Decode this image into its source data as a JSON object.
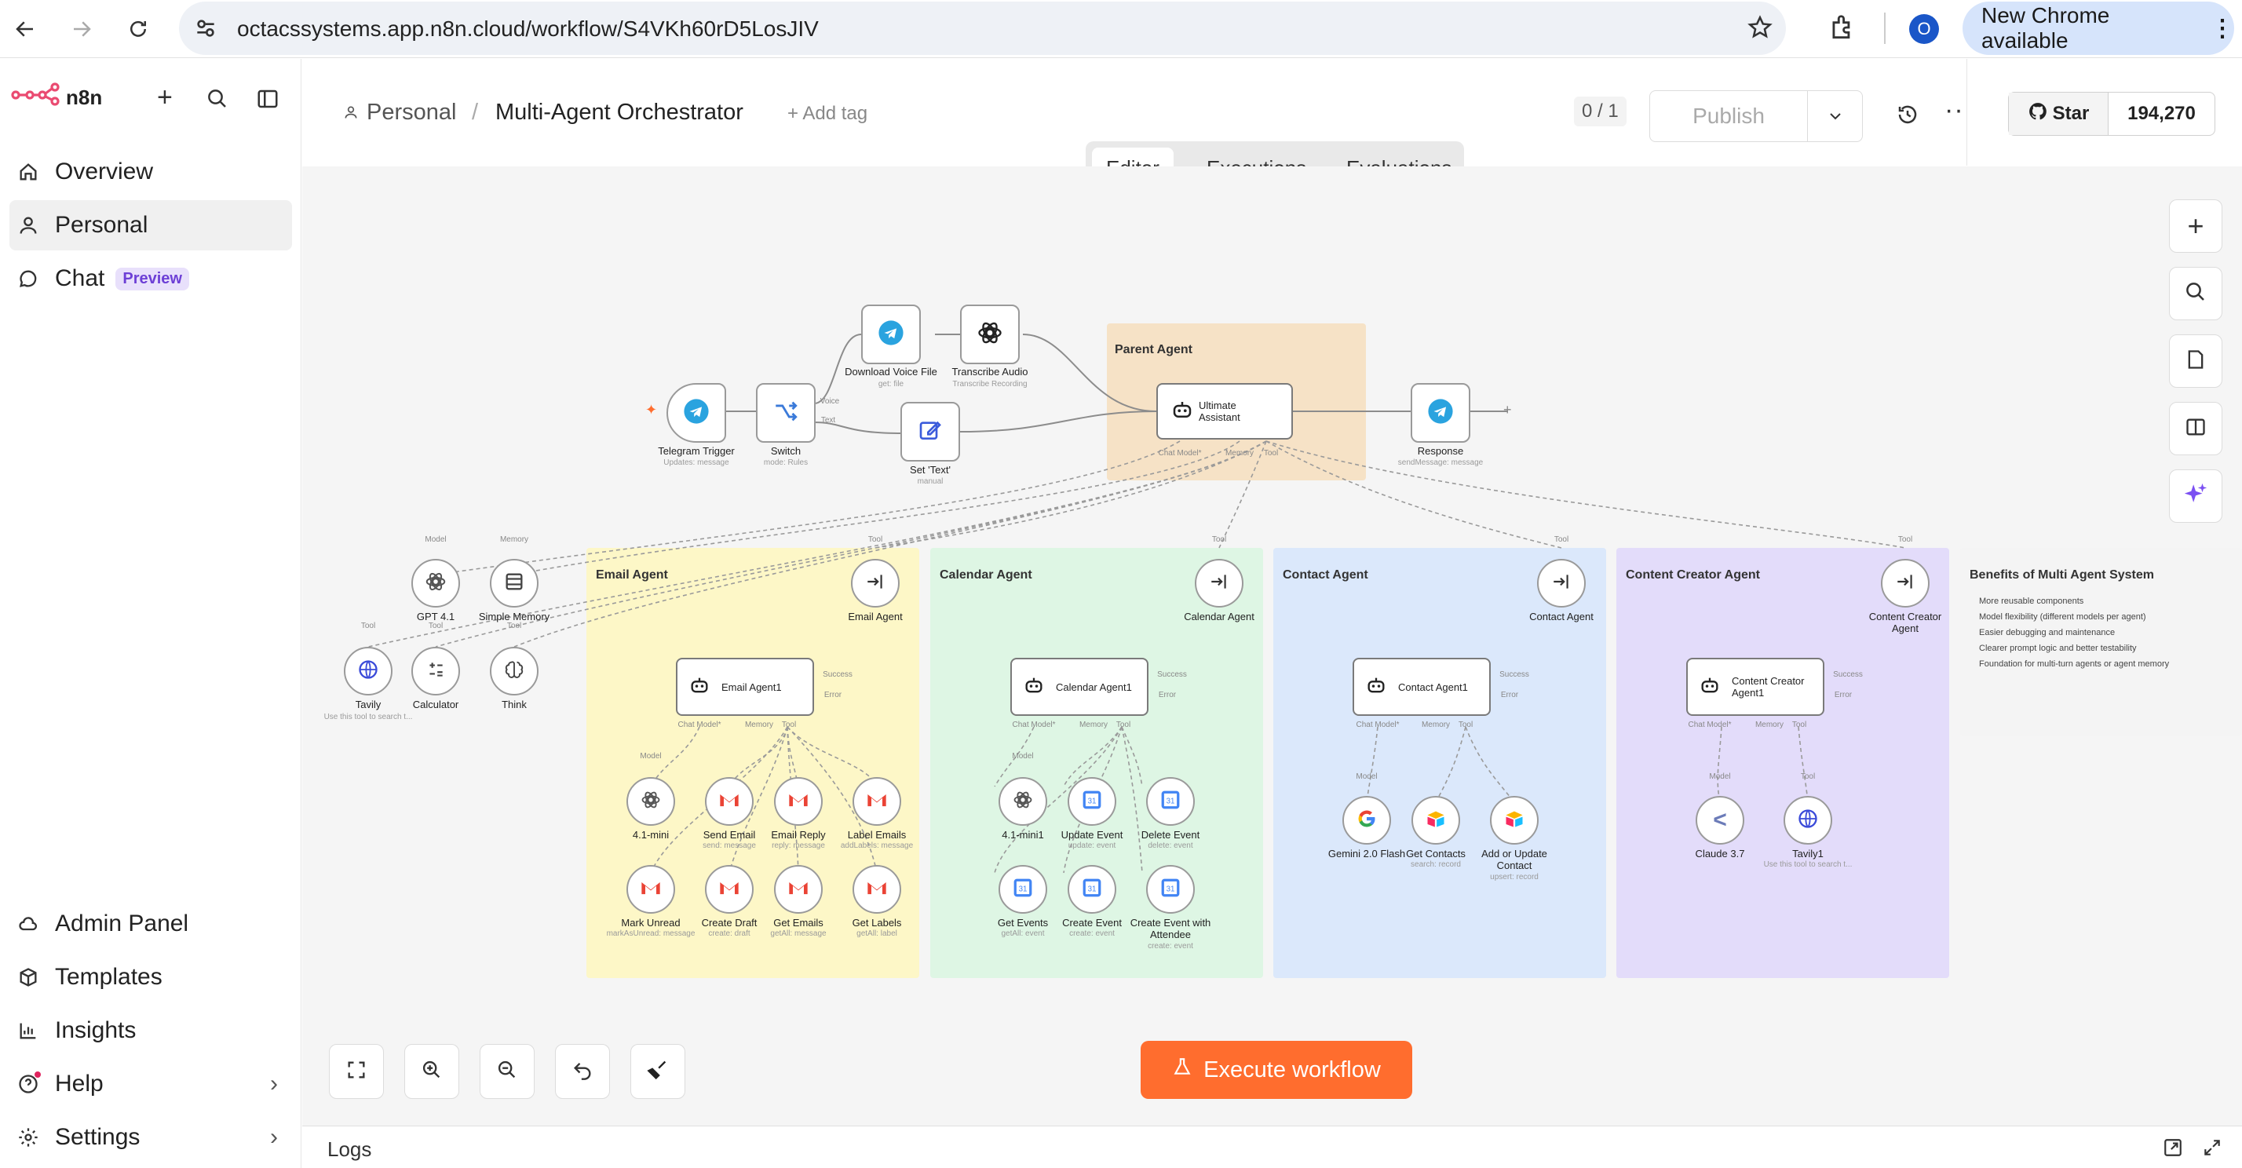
{
  "browser": {
    "url": "octacssystems.app.n8n.cloud/workflow/S4VKh60rD5LosJIV",
    "profile_initial": "O",
    "new_chrome": "New Chrome available"
  },
  "sidebar": {
    "brand": "n8n",
    "top_items": [
      {
        "label": "Overview",
        "icon": "home-icon"
      },
      {
        "label": "Personal",
        "icon": "user-icon"
      },
      {
        "label": "Chat",
        "icon": "chat-icon",
        "badge": "Preview"
      }
    ],
    "bottom_items": [
      {
        "label": "Admin Panel",
        "icon": "cloud-icon"
      },
      {
        "label": "Templates",
        "icon": "box-icon"
      },
      {
        "label": "Insights",
        "icon": "chart-icon"
      },
      {
        "label": "Help",
        "icon": "help-icon"
      },
      {
        "label": "Settings",
        "icon": "gear-icon"
      }
    ]
  },
  "header": {
    "project": "Personal",
    "separator": "/",
    "workflow_name": "Multi-Agent Orchestrator",
    "add_tag": "+ Add tag",
    "counter": "0 / 1",
    "publish": "Publish",
    "github_star": "Star",
    "github_count": "194,270"
  },
  "tabs": [
    "Editor",
    "Executions",
    "Evaluations"
  ],
  "canvas": {
    "execute": "Execute workflow",
    "logs": "Logs",
    "nodes": {
      "telegram_trigger": {
        "label": "Telegram Trigger",
        "sub": "Updates: message"
      },
      "switch": {
        "label": "Switch",
        "sub": "mode: Rules",
        "out1": "Voice",
        "out2": "Text"
      },
      "download": {
        "label": "Download Voice File",
        "sub": "get: file"
      },
      "transcribe": {
        "label": "Transcribe Audio",
        "sub": "Transcribe Recording"
      },
      "set_text": {
        "label": "Set 'Text'",
        "sub": "manual"
      },
      "ultimate": {
        "label1": "Ultimate",
        "label2": "Assistant",
        "p1": "Chat Model*",
        "p2": "Memory",
        "p3": "Tool"
      },
      "response": {
        "label": "Response",
        "sub": "sendMessage: message"
      },
      "gpt41": {
        "label": "GPT 4.1",
        "top": "Model"
      },
      "simple_memory": {
        "label": "Simple Memory",
        "top": "Memory"
      },
      "tavily": {
        "label": "Tavily",
        "top": "Tool",
        "sub": "Use this tool to search t..."
      },
      "calculator": {
        "label": "Calculator",
        "top": "Tool"
      },
      "think": {
        "label": "Think",
        "top": "Tool"
      }
    },
    "groups": [
      {
        "title": "Parent Agent",
        "color": "#f6e2c6"
      },
      {
        "title": "Email Agent",
        "color": "#fdf7c7",
        "tool_label": "Email Agent",
        "agent": "Email Agent1",
        "children": [
          {
            "label": "4.1-mini",
            "top": "Model"
          },
          {
            "label": "Send Email",
            "sub": "send: message"
          },
          {
            "label": "Email Reply",
            "sub": "reply: message"
          },
          {
            "label": "Label Emails",
            "sub": "addLabels: message"
          },
          {
            "label": "Mark Unread",
            "sub": "markAsUnread: message"
          },
          {
            "label": "Create Draft",
            "sub": "create: draft"
          },
          {
            "label": "Get Emails",
            "sub": "getAll: message"
          },
          {
            "label": "Get Labels",
            "sub": "getAll: label"
          }
        ]
      },
      {
        "title": "Calendar Agent",
        "color": "#def6e4",
        "tool_label": "Calendar Agent",
        "agent": "Calendar Agent1",
        "children": [
          {
            "label": "4.1-mini1",
            "top": "Model"
          },
          {
            "label": "Update Event",
            "sub": "update: event"
          },
          {
            "label": "Delete Event",
            "sub": "delete: event"
          },
          {
            "label": "Get Events",
            "sub": "getAll: event"
          },
          {
            "label": "Create Event",
            "sub": "create: event"
          },
          {
            "label": "Create Event with Attendee",
            "sub": "create: event"
          }
        ]
      },
      {
        "title": "Contact Agent",
        "color": "#dbe8fb",
        "tool_label": "Contact Agent",
        "agent": "Contact Agent1",
        "children": [
          {
            "label": "Gemini 2.0 Flash",
            "top": "Model"
          },
          {
            "label": "Get Contacts",
            "sub": "search: record"
          },
          {
            "label": "Add or Update Contact",
            "sub": "upsert: record"
          }
        ]
      },
      {
        "title": "Content Creator Agent",
        "color": "#e3dcfa",
        "tool_label": "Content Creator Agent",
        "agent": "Content Creator Agent1",
        "children": [
          {
            "label": "Claude 3.7",
            "top": "Model"
          },
          {
            "label": "Tavily1",
            "top": "Tool",
            "sub": "Use this tool to search t..."
          }
        ]
      }
    ],
    "ports": {
      "chat_model": "Chat Model*",
      "memory": "Memory",
      "tool": "Tool",
      "success": "Success",
      "error": "Error",
      "tool_top": "Tool"
    },
    "note": {
      "title": "Benefits of Multi Agent System",
      "items": [
        "More reusable components",
        "Model flexibility (different models per agent)",
        "Easier debugging and maintenance",
        "Clearer prompt logic and better testability",
        "Foundation for multi-turn agents or agent memory"
      ]
    }
  }
}
